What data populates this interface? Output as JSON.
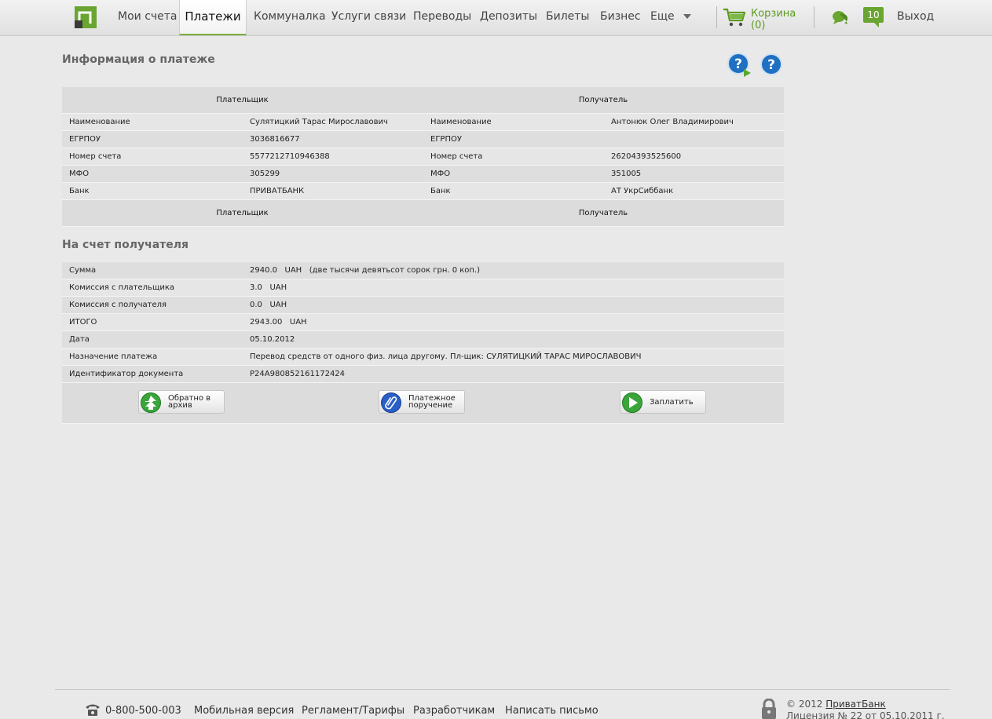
{
  "nav": {
    "items": [
      "Мои счета",
      "Платежи",
      "Коммуналка",
      "Услуги связи",
      "Переводы",
      "Депозиты",
      "Билеты",
      "Бизнес",
      "Еще"
    ],
    "cart_label": "Корзина (0)",
    "messages_count": "10",
    "logout": "Выход"
  },
  "payment_info": {
    "title": "Информация о платеже",
    "payer_header": "Плательщик",
    "recipient_header": "Получатель",
    "rows": [
      {
        "label": "Наименование",
        "payer": "Сулятицкий Тарас Мирославович",
        "label2": "Наименование",
        "recipient": "Антонюк Олег Владимирович"
      },
      {
        "label": "ЕГРПОУ",
        "payer": "3036816677",
        "label2": "ЕГРПОУ",
        "recipient": ""
      },
      {
        "label": "Номер счета",
        "payer": "5577212710946388",
        "label2": "Номер счета",
        "recipient": "26204393525600"
      },
      {
        "label": "МФО",
        "payer": "305299",
        "label2": "МФО",
        "recipient": "351005"
      },
      {
        "label": "Банк",
        "payer": "ПРИВАТБАНК",
        "label2": "Банк",
        "recipient": "АТ УкрСиббанк"
      }
    ]
  },
  "recipient_account": {
    "title": "На счет получателя",
    "rows": [
      {
        "label": "Сумма",
        "value": "2940.0   UAH   (две тысячи девятьсот сорок грн. 0 коп.)"
      },
      {
        "label": "Комиссия с плательщика",
        "value": "3.0   UAH"
      },
      {
        "label": "Комиссия с получателя",
        "value": "0.0   UAH"
      },
      {
        "label": "ИТОГО",
        "value": "2943.00   UAH"
      },
      {
        "label": "Дата",
        "value": "05.10.2012"
      },
      {
        "label": "Назначение платежа",
        "value": "Перевод средств от одного физ. лица другому. Пл-щик: СУЛЯТИЦКИЙ ТАРАС МИРОСЛАВОВИЧ"
      },
      {
        "label": "Идентификатор документа",
        "value": "P24A980852161172424"
      }
    ]
  },
  "actions": {
    "back_line1": "Обратно в",
    "back_line2": "архив",
    "order_line1": "Платежное",
    "order_line2": "поручение",
    "pay": "Заплатить"
  },
  "footer": {
    "phone": "0-800-500-003",
    "links": [
      "Мобильная версия",
      "Регламент/Тарифы",
      "Разработчикам",
      "Написать письмо"
    ],
    "copyright": "© 2012",
    "company": "ПриватБанк",
    "license": "Лицензия № 22 от 05.10.2011 г."
  },
  "colors": {
    "brand_green": "#6aa531",
    "cart_green": "#5c9a1e",
    "help_blue": "#1f6fc2"
  }
}
